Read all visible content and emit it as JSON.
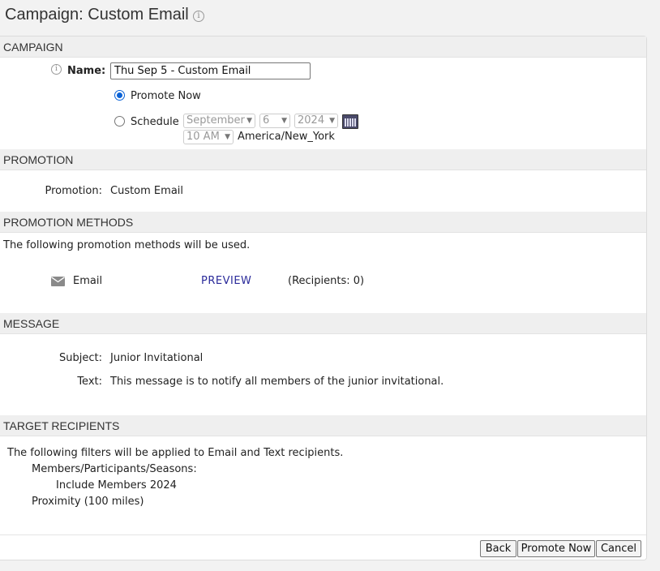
{
  "page": {
    "title": "Campaign: Custom Email"
  },
  "campaign": {
    "header": "CAMPAIGN",
    "name_label": "Name:",
    "name_value": "Thu Sep 5 - Custom Email",
    "promote_now_label": "Promote Now",
    "schedule_label": "Schedule",
    "selected_option": "Promote Now",
    "month": "September",
    "day": "6",
    "year": "2024",
    "time": "10 AM",
    "timezone": "America/New_York"
  },
  "promotion": {
    "header": "PROMOTION",
    "label": "Promotion:",
    "value": "Custom Email"
  },
  "methods": {
    "header": "PROMOTION METHODS",
    "intro": "The following promotion methods will be used.",
    "items": [
      {
        "name": "Email",
        "icon": "envelope-icon",
        "action": "PREVIEW",
        "recipients": "(Recipients: 0)"
      }
    ]
  },
  "message": {
    "header": "MESSAGE",
    "subject_label": "Subject:",
    "subject_value": "Junior Invitational",
    "text_label": "Text:",
    "text_value": "This message is to notify all members of the junior invitational."
  },
  "targets": {
    "header": "TARGET RECIPIENTS",
    "intro": "The following filters will be applied to Email and Text recipients.",
    "filters": [
      "Members/Participants/Seasons:",
      "Include Members 2024",
      "Proximity (100 miles)"
    ]
  },
  "buttons": {
    "back": "Back",
    "promote_now": "Promote Now",
    "cancel": "Cancel"
  },
  "colors": {
    "accent": "#0b62d6",
    "link": "#2a2a9a",
    "section_header_bg": "#efefef"
  }
}
